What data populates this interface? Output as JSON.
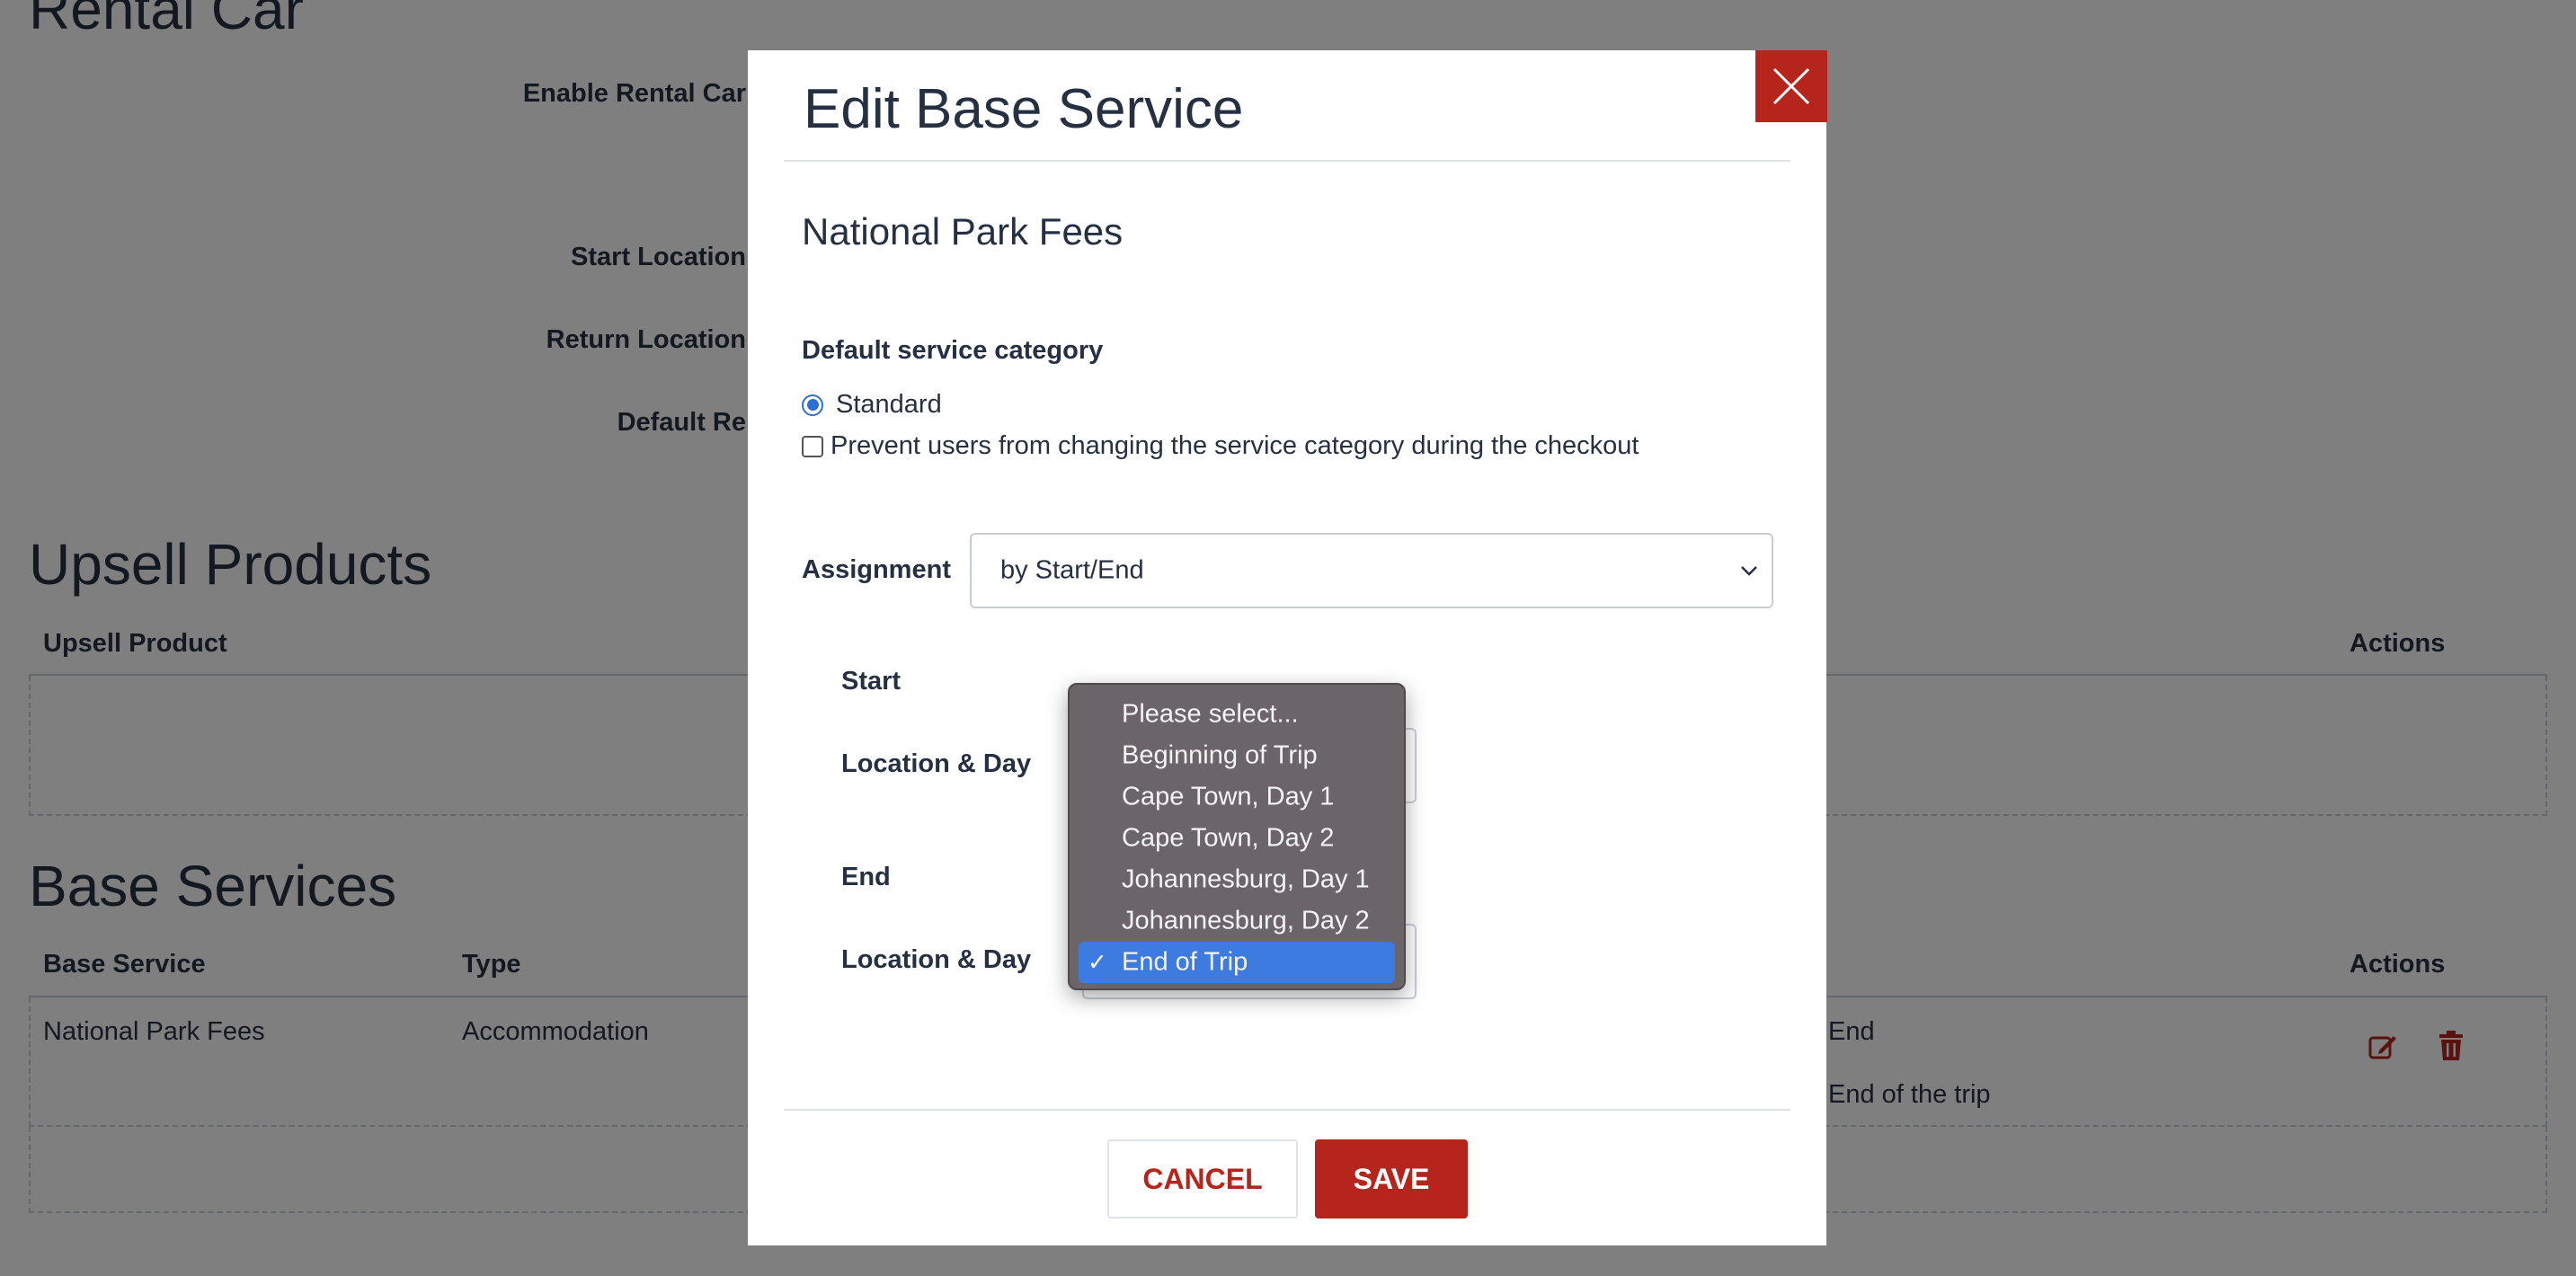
{
  "page": {
    "rental_title": "Rental Car",
    "rental_labels": {
      "enable": "Enable Rental Car",
      "start": "Start Location",
      "return": "Return Location",
      "default": "Default Re"
    },
    "upsell": {
      "title": "Upsell Products",
      "col_product": "Upsell Product",
      "col_actions": "Actions"
    },
    "base": {
      "title": "Base Services",
      "col_service": "Base Service",
      "col_type": "Type",
      "col_actions": "Actions",
      "rows": [
        {
          "service": "National Park Fees",
          "type": "Accommodation",
          "assign_end": "End",
          "assign_end_detail": "End of the trip"
        }
      ]
    }
  },
  "modal": {
    "title": "Edit Base Service",
    "service_name": "National Park Fees",
    "category_label": "Default service category",
    "category_option": "Standard",
    "prevent_label": "Prevent users from changing the service category during the checkout",
    "assignment_label": "Assignment",
    "assignment_value": "by Start/End",
    "start_heading": "Start",
    "start_location_label": "Location & Day",
    "end_heading": "End",
    "end_location_label": "Location & Day",
    "cancel_label": "CANCEL",
    "save_label": "SAVE",
    "dropdown_options": [
      "Please select...",
      "Beginning of Trip",
      "Cape Town, Day 1",
      "Cape Town, Day 2",
      "Johannesburg, Day 1",
      "Johannesburg, Day 2",
      "End of Trip"
    ],
    "dropdown_selected_check": "✓"
  },
  "colors": {
    "accent_red": "#b5251c",
    "selection_blue": "#3d7be0"
  }
}
